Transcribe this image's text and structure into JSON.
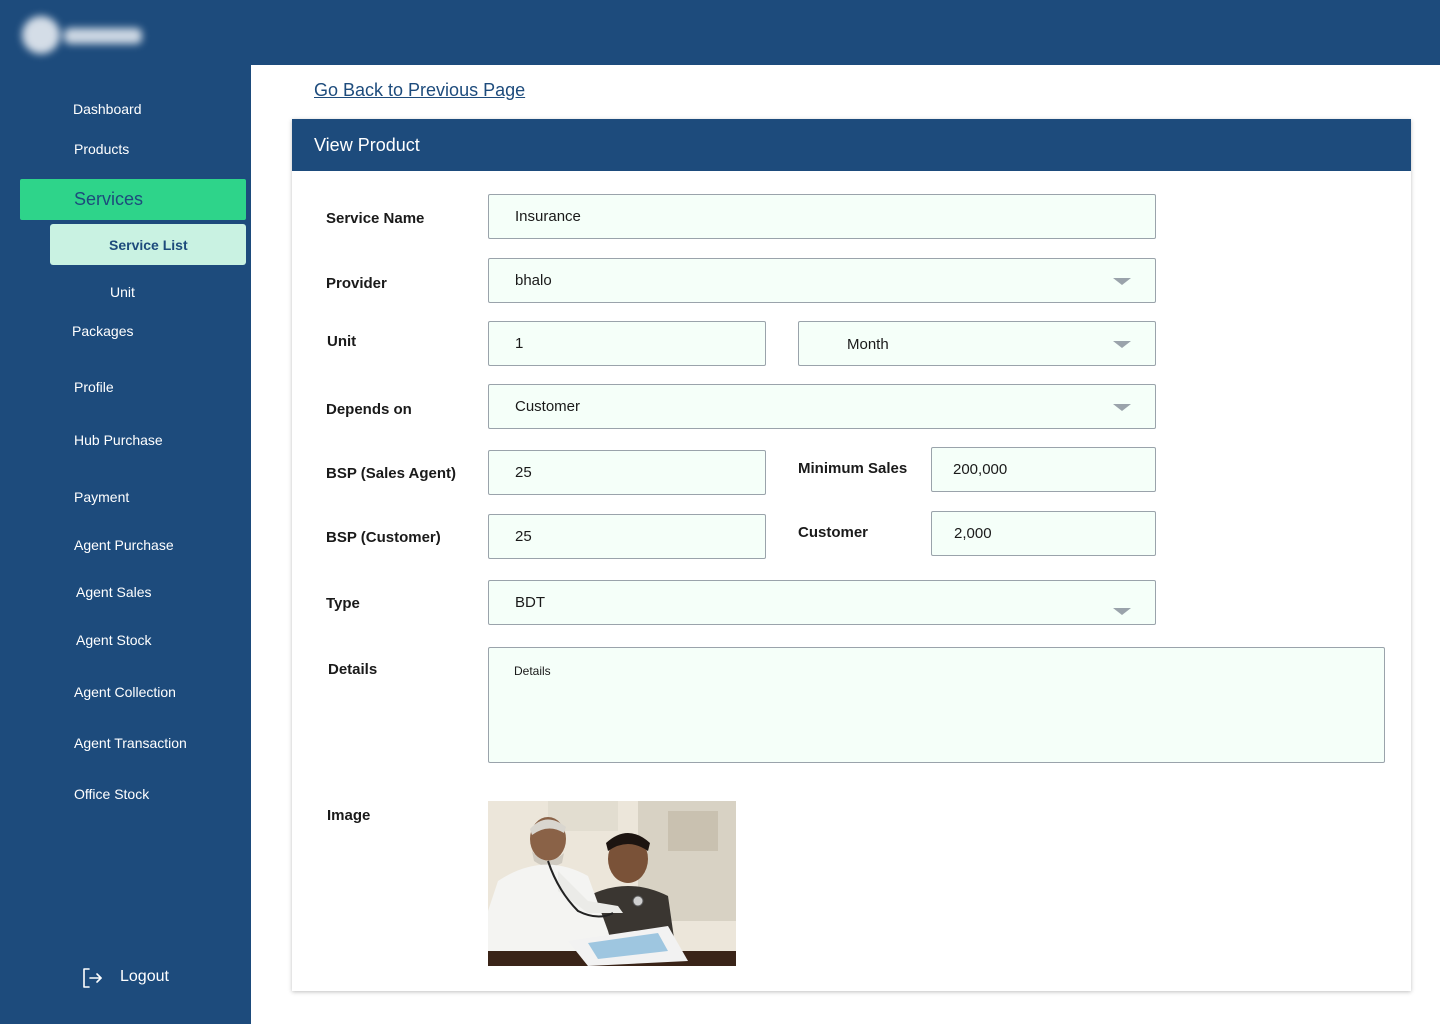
{
  "app": {
    "logo": "logo"
  },
  "sidebar": {
    "items": [
      {
        "label": "Dashboard"
      },
      {
        "label": "Products"
      },
      {
        "label": "Services"
      },
      {
        "label": "Service List"
      },
      {
        "label": "Unit"
      },
      {
        "label": "Packages"
      },
      {
        "label": "Profile"
      },
      {
        "label": "Hub Purchase"
      },
      {
        "label": "Payment"
      },
      {
        "label": "Agent Purchase"
      },
      {
        "label": "Agent Sales"
      },
      {
        "label": "Agent Stock"
      },
      {
        "label": "Agent Collection"
      },
      {
        "label": "Agent Transaction"
      },
      {
        "label": "Office Stock"
      }
    ],
    "logout_label": "Logout"
  },
  "main": {
    "back_link": "Go Back to Previous Page",
    "card_title": "View Product",
    "form": {
      "service_name": {
        "label": "Service Name",
        "value": "Insurance"
      },
      "provider": {
        "label": "Provider",
        "value": "bhalo"
      },
      "unit": {
        "label": "Unit",
        "value": "1",
        "period": "Month"
      },
      "depends_on": {
        "label": "Depends on",
        "value": "Customer"
      },
      "bsp_sales_agent": {
        "label": "BSP (Sales Agent)",
        "value": "25"
      },
      "minimum_sales": {
        "label": "Minimum Sales",
        "value": "200,000"
      },
      "bsp_customer": {
        "label": "BSP (Customer)",
        "value": "25"
      },
      "customer": {
        "label": "Customer",
        "value": "2,000"
      },
      "type": {
        "label": "Type",
        "value": "BDT"
      },
      "details": {
        "label": "Details",
        "value": "Details"
      },
      "image": {
        "label": "Image"
      }
    }
  },
  "colors": {
    "primary": "#1d4b7c",
    "active": "#2ed48a",
    "sub_active": "#c9f2e2",
    "field_bg": "#f5fff9"
  }
}
